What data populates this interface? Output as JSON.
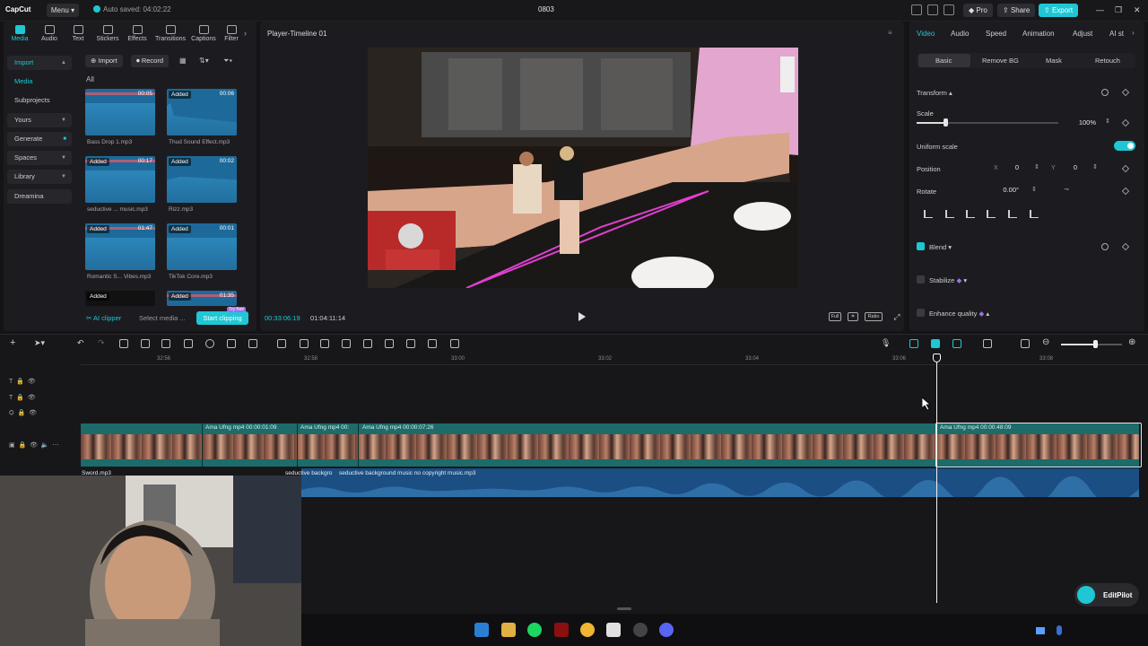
{
  "titlebar": {
    "app_name": "CapCut",
    "menu_label": "Menu",
    "autosave": "Auto saved: 04:02:22",
    "project_title": "0803",
    "pro_label": "Pro",
    "share_label": "Share",
    "export_label": "Export"
  },
  "left_tabs": [
    "Media",
    "Audio",
    "Text",
    "Stickers",
    "Effects",
    "Transitions",
    "Captions",
    "Filter"
  ],
  "left_nav": {
    "import": "Import",
    "media": "Media",
    "subprojects": "Subprojects",
    "yours": "Yours",
    "generate": "Generate",
    "spaces": "Spaces",
    "library": "Library",
    "dreamina": "Dreamina"
  },
  "media_toolbar": {
    "import": "Import",
    "record": "Record",
    "filter_all": "All"
  },
  "media_items": [
    {
      "name": "Bass Drop 1.mp3",
      "added": "",
      "duration": "00:05"
    },
    {
      "name": "Thud Sound Effect.mp3",
      "added": "Added",
      "duration": "00:06"
    },
    {
      "name": "seductive ... music.mp3",
      "added": "Added",
      "duration": "00:17"
    },
    {
      "name": "Rizz.mp3",
      "added": "Added",
      "duration": "00:02"
    },
    {
      "name": "Romantic S... Vibes.mp3",
      "added": "Added",
      "duration": "01:47"
    },
    {
      "name": "TikTok Core.mp3",
      "added": "Added",
      "duration": "00:01"
    },
    {
      "name": "",
      "added": "Added",
      "duration": ""
    },
    {
      "name": "",
      "added": "Added",
      "duration": "01:35"
    }
  ],
  "clipper": {
    "ai_clipper": "AI clipper",
    "select_media": "Select media ...",
    "start_clipping": "Start clipping",
    "try_free": "Try free"
  },
  "player": {
    "title": "Player-Timeline 01",
    "current_time": "00:33:06:19",
    "total_time": "01:04:11:14",
    "full_label": "Full",
    "ratio_label": "Ratio"
  },
  "right_tabs": [
    "Video",
    "Audio",
    "Speed",
    "Animation",
    "Adjust",
    "AI st"
  ],
  "right_subtabs": [
    "Basic",
    "Remove BG",
    "Mask",
    "Retouch"
  ],
  "transform": {
    "section": "Transform",
    "scale_label": "Scale",
    "scale_value": "100%",
    "uniform_scale": "Uniform scale",
    "position_label": "Position",
    "pos_x_label": "X",
    "pos_x": "0",
    "pos_y_label": "Y",
    "pos_y": "0",
    "rotate_label": "Rotate",
    "rotate_value": "0.00°",
    "scale_fraction": 0.2
  },
  "options": {
    "blend": "Blend",
    "stabilize": "Stabilize",
    "enhance_quality": "Enhance quality"
  },
  "ruler": [
    "32:56",
    "32:58",
    "33:00",
    "33:02",
    "33:04",
    "33:06",
    "33:08"
  ],
  "clips": {
    "video": [
      {
        "label": "Ama Ufng mp4   00:00:01:09"
      },
      {
        "label": "Ama Ufng mp4   00:"
      },
      {
        "label": "Ama Ufng mp4   00:00:07:26"
      },
      {
        "label": "Ama Ufng mp4   00:00:48:09"
      }
    ],
    "audio": [
      {
        "label": "Sword.mp3"
      },
      {
        "label": "seductive backgro"
      },
      {
        "label": "seductive background music no copyright music.mp3"
      }
    ]
  },
  "editpilot": "EditPilot",
  "colors": {
    "accent": "#1fc7d4",
    "video_clip": "#1d6b6a",
    "audio_clip": "#1b4e82",
    "pro": "#a46cf0"
  }
}
